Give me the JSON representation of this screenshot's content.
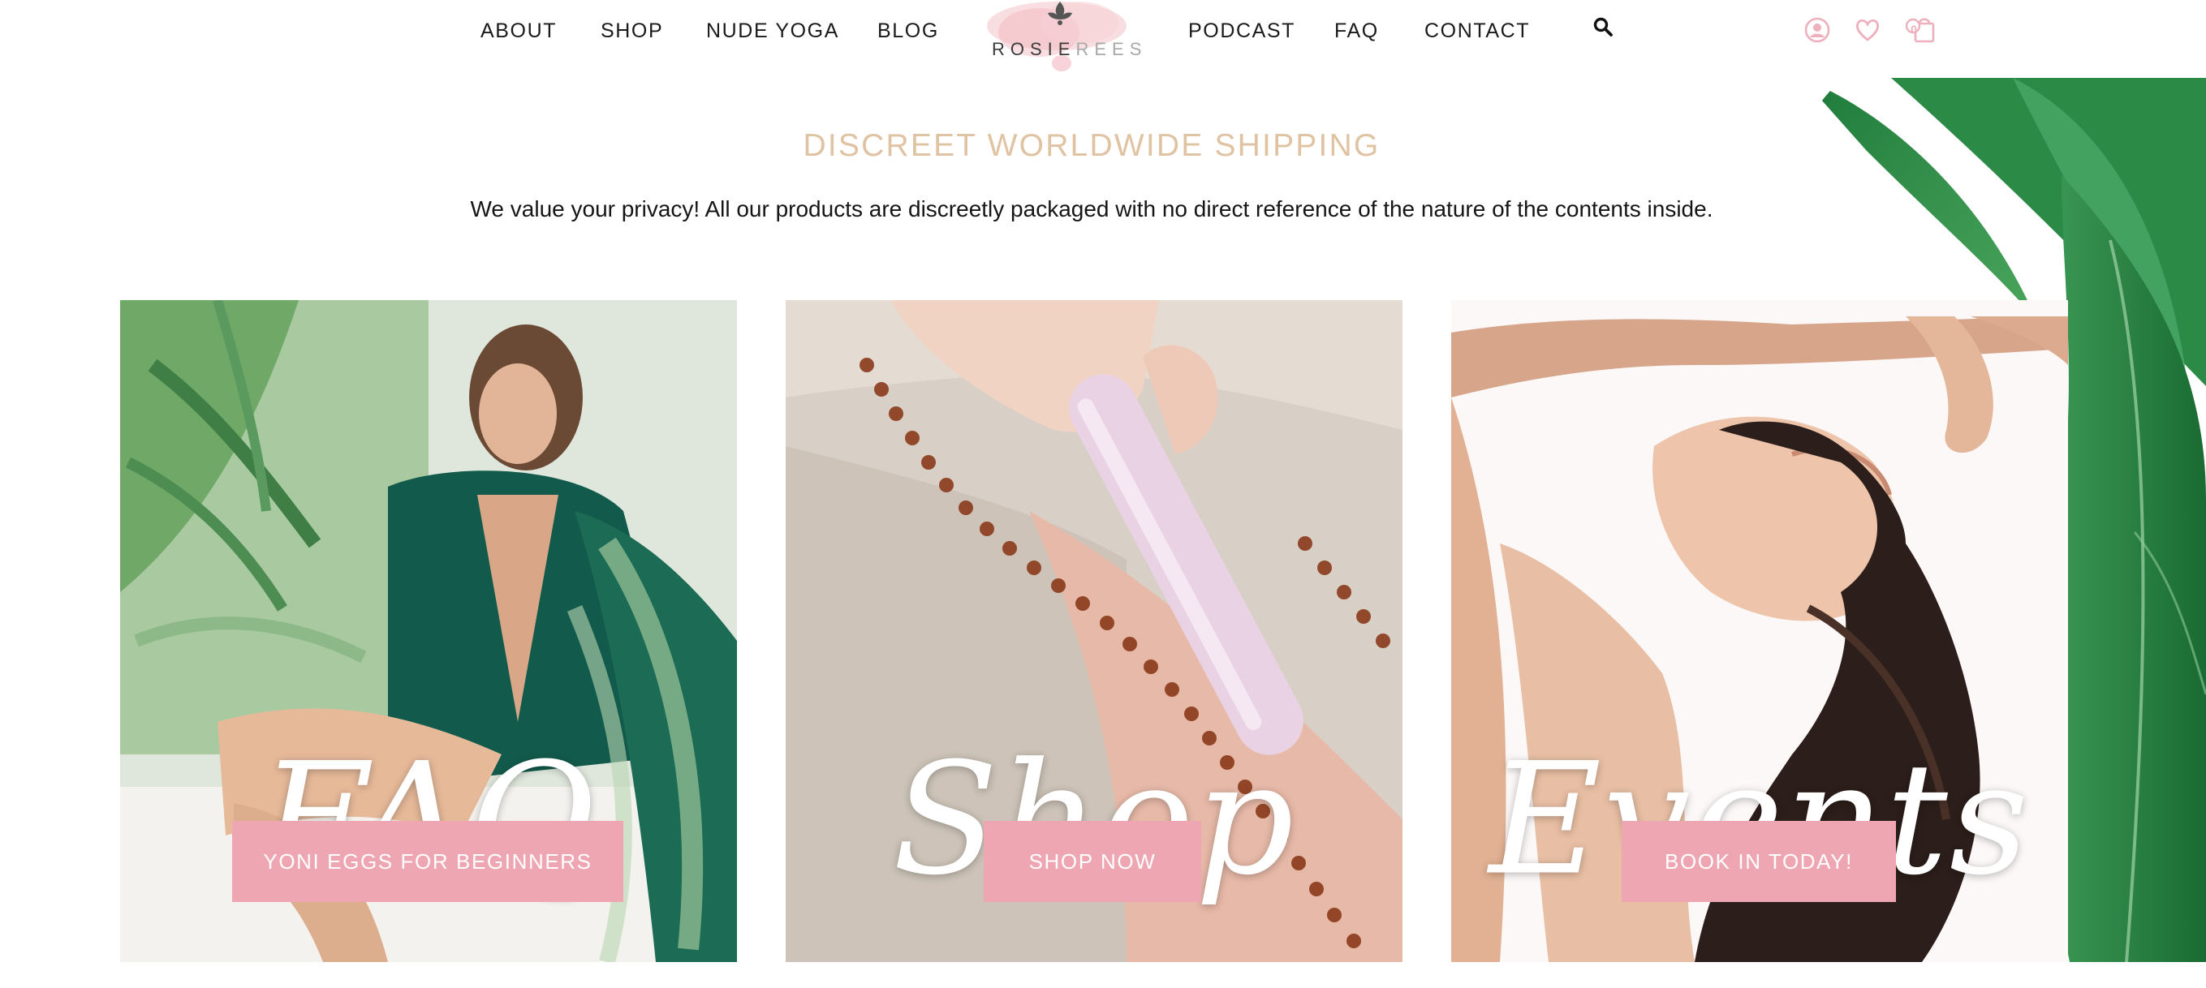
{
  "nav": {
    "left": [
      "ABOUT",
      "SHOP",
      "NUDE YOGA",
      "BLOG"
    ],
    "right": [
      "PODCAST",
      "FAQ",
      "CONTACT"
    ]
  },
  "logo": {
    "part1": "ROSIE",
    "part2": "REES"
  },
  "header_icons": [
    "search-icon",
    "account-icon",
    "wishlist-heart-icon",
    "cart-bag-icon"
  ],
  "cart": {
    "count": "0"
  },
  "shipping": {
    "title": "DISCREET WORLDWIDE SHIPPING",
    "text": "We value your privacy! All our products are discreetly packaged with no direct reference of the nature of the contents inside."
  },
  "tiles": [
    {
      "script": "FAQ",
      "button": "YONI EGGS FOR BEGINNERS"
    },
    {
      "script": "Shop",
      "button": "SHOP NOW"
    },
    {
      "script": "Events",
      "button": "BOOK IN TODAY!"
    }
  ],
  "colors": {
    "accent_pink": "#eea6b2",
    "shipping_title": "#dfc3a2",
    "icon_pink": "#efb0bd",
    "leaf_green": "#2f8b4a"
  }
}
